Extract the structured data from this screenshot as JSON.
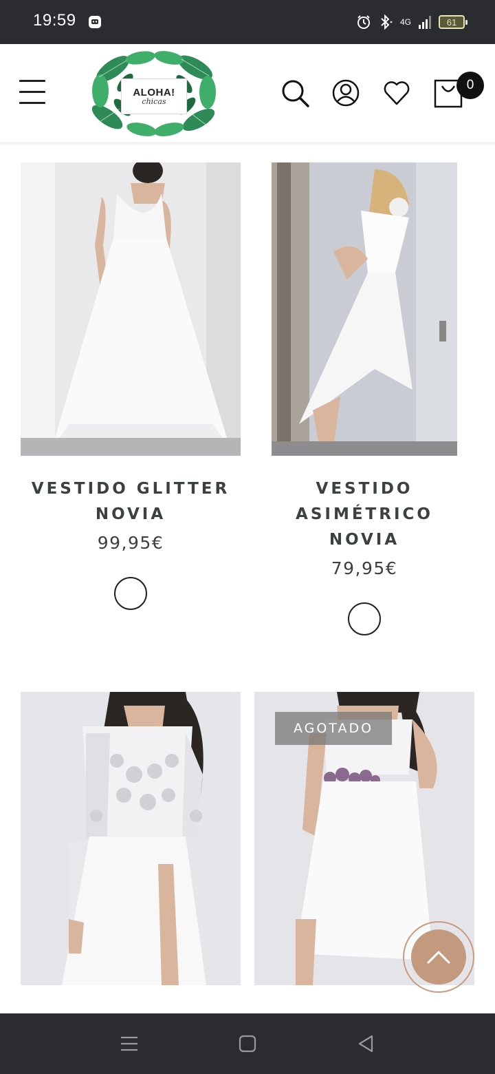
{
  "status_bar": {
    "time": "19:59",
    "network": "4G",
    "battery": "61"
  },
  "header": {
    "logo": {
      "main": "ALOHA!",
      "sub": "chicas"
    },
    "cart_count": "0"
  },
  "products": [
    {
      "title_lines": [
        "VESTIDO GLITTER",
        "NOVIA"
      ],
      "price": "99,95€"
    },
    {
      "title_lines": [
        "VESTIDO",
        "ASIMÉTRICO",
        "NOVIA"
      ],
      "price": "79,95€"
    },
    {
      "title_lines": [],
      "price": ""
    },
    {
      "title_lines": [],
      "price": "",
      "badge": "AGOTADO"
    }
  ],
  "colors": {
    "status_bar_bg": "#2b2c30",
    "text": "#3a413f",
    "scroll_top_button": "#c49a7f"
  },
  "icons": [
    "menu-icon",
    "search-icon",
    "account-icon",
    "heart-icon",
    "cart-icon",
    "arrow-up-icon",
    "nav-menu-icon",
    "nav-home-icon",
    "nav-back-icon"
  ]
}
